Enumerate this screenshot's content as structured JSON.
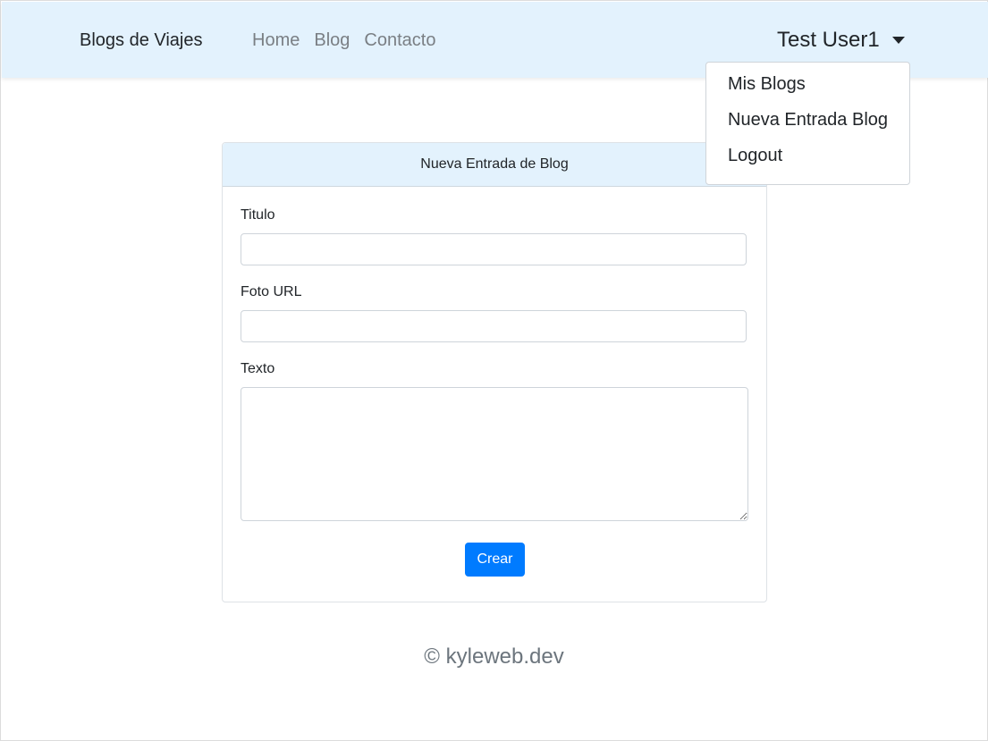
{
  "navbar": {
    "brand": "Blogs de Viajes",
    "links": [
      "Home",
      "Blog",
      "Contacto"
    ],
    "user": "Test User1"
  },
  "dropdown": {
    "items": [
      "Mis Blogs",
      "Nueva Entrada Blog",
      "Logout"
    ]
  },
  "form": {
    "title": "Nueva Entrada de Blog",
    "fields": {
      "titulo": {
        "label": "Titulo",
        "value": "",
        "placeholder": ""
      },
      "foto_url": {
        "label": "Foto URL",
        "value": "",
        "placeholder": ""
      },
      "texto": {
        "label": "Texto",
        "value": "",
        "placeholder": ""
      }
    },
    "submit_label": "Crear"
  },
  "footer": {
    "text": "© kyleweb.dev"
  },
  "colors": {
    "navbar_bg": "#e3f2fd",
    "primary": "#007bff",
    "muted_link": "#7a7f84"
  }
}
